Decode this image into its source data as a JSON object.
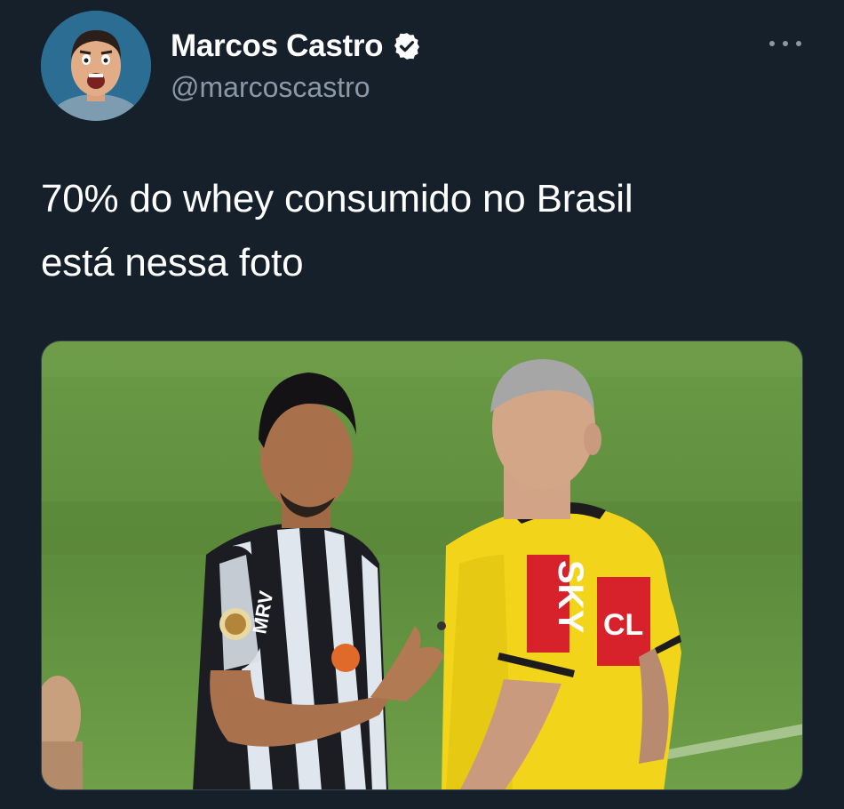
{
  "tweet": {
    "author": {
      "display_name": "Marcos Castro",
      "handle": "@marcoscastro",
      "verified": true,
      "avatar_icon": "profile-photo"
    },
    "more_icon": "more-horizontal-icon",
    "text_lines": [
      "70% do whey consumido no Brasil",
      "está nessa foto"
    ],
    "media": {
      "kind": "photo",
      "jersey_text": {
        "player_chest": "MRV",
        "referee_chest": "SKY",
        "referee_sleeve": "CL"
      }
    }
  },
  "colors": {
    "background": "#15202b",
    "text_primary": "#ffffff",
    "text_secondary": "#8b98a5",
    "pitch_green": "#5f8f3e",
    "referee_yellow": "#f2d51a",
    "sponsor_red": "#d8222b"
  }
}
